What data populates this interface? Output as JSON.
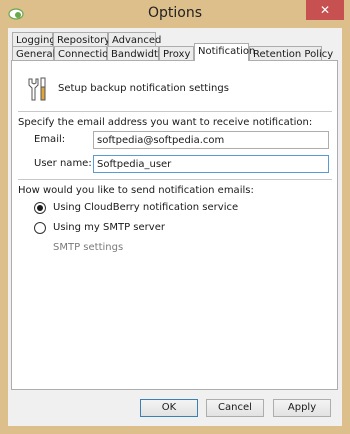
{
  "window": {
    "title": "Options",
    "close_glyph": "✕"
  },
  "tabs_row1": [
    {
      "label": "Logging"
    },
    {
      "label": "Repository"
    },
    {
      "label": "Advanced"
    }
  ],
  "tabs_row2": [
    {
      "label": "General"
    },
    {
      "label": "Connection"
    },
    {
      "label": "Bandwidth"
    },
    {
      "label": "Proxy"
    },
    {
      "label": "Notification",
      "active": true
    },
    {
      "label": "Retention Policy"
    }
  ],
  "panel": {
    "header_text": "Setup backup notification settings",
    "email_section_title": "Specify the email address you want to receive notification:",
    "email_label": "Email:",
    "email_value": "softpedia@softpedia.com",
    "username_label": "User name:",
    "username_value": "Softpedia_user",
    "send_section_title": "How would you like to send notification emails:",
    "option_cloudberry": "Using CloudBerry notification service",
    "option_smtp": "Using my SMTP server",
    "smtp_settings": "SMTP settings",
    "selected_option": "cloudberry"
  },
  "buttons": {
    "ok": "OK",
    "cancel": "Cancel",
    "apply": "Apply"
  },
  "colors": {
    "frame": "#dcbf8a",
    "close": "#c75050",
    "focus": "#5b9bd5"
  },
  "icons": {
    "app": "cloud-icon",
    "header": "tools-icon"
  }
}
